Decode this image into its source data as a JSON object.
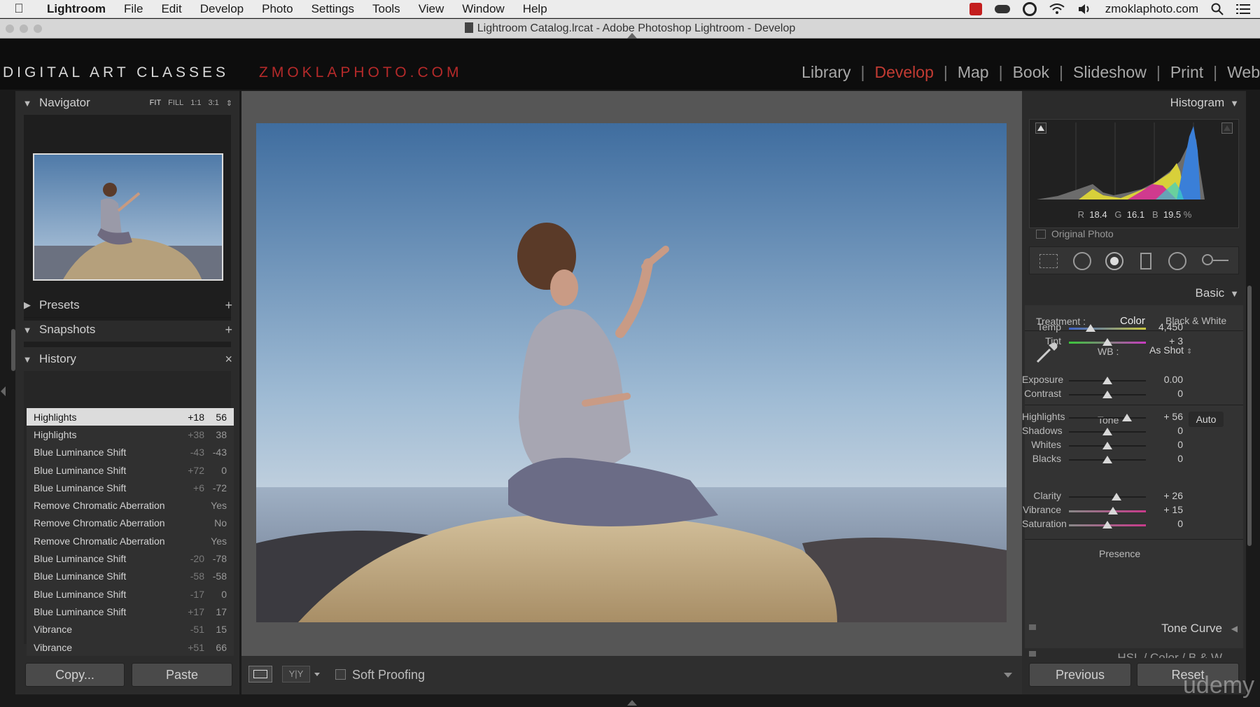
{
  "menubar": {
    "app": "Lightroom",
    "items": [
      "File",
      "Edit",
      "Develop",
      "Photo",
      "Settings",
      "Tools",
      "View",
      "Window",
      "Help"
    ],
    "site": "zmoklaphoto.com"
  },
  "titlebar": {
    "title": "Lightroom Catalog.lrcat - Adobe Photoshop Lightroom - Develop"
  },
  "identity": {
    "plate": "DIGITAL ART CLASSES",
    "site": "ZMOKLAPHOTO.COM"
  },
  "modules": [
    "Library",
    "Develop",
    "Map",
    "Book",
    "Slideshow",
    "Print",
    "Web"
  ],
  "active_module": "Develop",
  "navigator": {
    "title": "Navigator",
    "zoom": [
      "FIT",
      "FILL",
      "1:1",
      "3:1"
    ]
  },
  "left_panels": {
    "presets": "Presets",
    "snapshots": "Snapshots",
    "history": "History"
  },
  "history": [
    {
      "name": "Highlights",
      "delta": "+18",
      "value": "56"
    },
    {
      "name": "Highlights",
      "delta": "+38",
      "value": "38"
    },
    {
      "name": "Blue Luminance Shift",
      "delta": "-43",
      "value": "-43"
    },
    {
      "name": "Blue Luminance Shift",
      "delta": "+72",
      "value": "0"
    },
    {
      "name": "Blue Luminance Shift",
      "delta": "+6",
      "value": "-72"
    },
    {
      "name": "Remove Chromatic Aberration",
      "delta": "",
      "value": "Yes"
    },
    {
      "name": "Remove Chromatic Aberration",
      "delta": "",
      "value": "No"
    },
    {
      "name": "Remove Chromatic Aberration",
      "delta": "",
      "value": "Yes"
    },
    {
      "name": "Blue Luminance Shift",
      "delta": "-20",
      "value": "-78"
    },
    {
      "name": "Blue Luminance Shift",
      "delta": "-58",
      "value": "-58"
    },
    {
      "name": "Blue Luminance Shift",
      "delta": "-17",
      "value": "0"
    },
    {
      "name": "Blue Luminance Shift",
      "delta": "+17",
      "value": "17"
    },
    {
      "name": "Vibrance",
      "delta": "-51",
      "value": "15"
    },
    {
      "name": "Vibrance",
      "delta": "+51",
      "value": "66"
    }
  ],
  "left_buttons": {
    "copy": "Copy...",
    "paste": "Paste"
  },
  "toolbar": {
    "soft_proofing": "Soft Proofing"
  },
  "histogram": {
    "title": "Histogram",
    "r_label": "R",
    "r": "18.4",
    "g_label": "G",
    "g": "16.1",
    "b_label": "B",
    "b": "19.5",
    "pct": "%",
    "original_photo": "Original Photo"
  },
  "basic": {
    "title": "Basic",
    "treatment_label": "Treatment :",
    "treatment_color": "Color",
    "treatment_bw": "Black & White",
    "wb_label": "WB :",
    "wb_value": "As Shot",
    "tone_label": "Tone",
    "auto": "Auto",
    "presence_label": "Presence",
    "sliders": [
      {
        "label": "Temp",
        "value": "4,450",
        "pos": 0.28
      },
      {
        "label": "Tint",
        "value": "+ 3",
        "pos": 0.5
      },
      {
        "label": "Exposure",
        "value": "0.00",
        "pos": 0.5
      },
      {
        "label": "Contrast",
        "value": "0",
        "pos": 0.5
      },
      {
        "label": "Highlights",
        "value": "+ 56",
        "pos": 0.75
      },
      {
        "label": "Shadows",
        "value": "0",
        "pos": 0.5
      },
      {
        "label": "Whites",
        "value": "0",
        "pos": 0.5
      },
      {
        "label": "Blacks",
        "value": "0",
        "pos": 0.5
      },
      {
        "label": "Clarity",
        "value": "+ 26",
        "pos": 0.62
      },
      {
        "label": "Vibrance",
        "value": "+ 15",
        "pos": 0.57
      },
      {
        "label": "Saturation",
        "value": "0",
        "pos": 0.5
      }
    ]
  },
  "right_panels": {
    "tone_curve": "Tone Curve",
    "hsl": "HSL / Color / B & W"
  },
  "right_buttons": {
    "previous": "Previous",
    "reset": "Reset"
  },
  "watermark": "udemy",
  "colors": {
    "accent": "#c23b33",
    "panel": "#2b2b2b",
    "center": "#565656"
  }
}
